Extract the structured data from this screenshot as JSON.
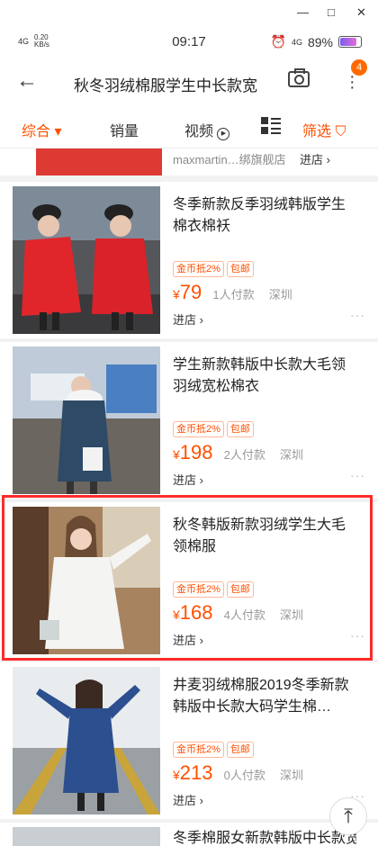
{
  "window": {
    "minimize": "—",
    "maximize": "□",
    "close": "✕"
  },
  "status_bar": {
    "signal": "4G",
    "speed_value": "0.20",
    "speed_unit": "KB/s",
    "time": "09:17",
    "alarm_icon": "alarm-icon",
    "net": "4G",
    "battery": "89%",
    "battery_level": 0.89
  },
  "search": {
    "query": "秋冬羽绒棉服学生中长款宽",
    "back_icon": "back-arrow-icon",
    "camera_icon": "camera-icon",
    "badge": "4"
  },
  "filters": {
    "comprehensive": "综合 ▾",
    "sales": "销量",
    "video": "视频",
    "screen": "筛选"
  },
  "partial_top": {
    "shop": "maxmartin…绑旗舰店",
    "enter": "进店 ›"
  },
  "products": [
    {
      "title": "冬季新款反季羽绒韩版学生棉衣棉袄",
      "tags": [
        "金币抵2%",
        "包邮"
      ],
      "price": "79",
      "buyers": "1人付款",
      "location": "深圳",
      "enter": "进店 ›"
    },
    {
      "title": "学生新款韩版中长款大毛领羽绒宽松棉衣",
      "tags": [
        "金币抵2%",
        "包邮"
      ],
      "price": "198",
      "buyers": "2人付款",
      "location": "深圳",
      "enter": "进店 ›"
    },
    {
      "title": "秋冬韩版新款羽绒学生大毛领棉服",
      "tags": [
        "金币抵2%",
        "包邮"
      ],
      "price": "168",
      "buyers": "4人付款",
      "location": "深圳",
      "enter": "进店 ›"
    },
    {
      "title": "井麦羽绒棉服2019冬季新款韩版中长款大码学生棉…",
      "tags": [
        "金币抵2%",
        "包邮"
      ],
      "price": "213",
      "buyers": "0人付款",
      "location": "深圳",
      "enter": "进店 ›"
    },
    {
      "title": "冬季棉服女新款韩版中长款宽"
    }
  ],
  "currency": "¥",
  "more_dots": "···",
  "scroll_top": "⤒",
  "colors": {
    "accent": "#ff5000",
    "highlight": "#ff2a2a"
  }
}
